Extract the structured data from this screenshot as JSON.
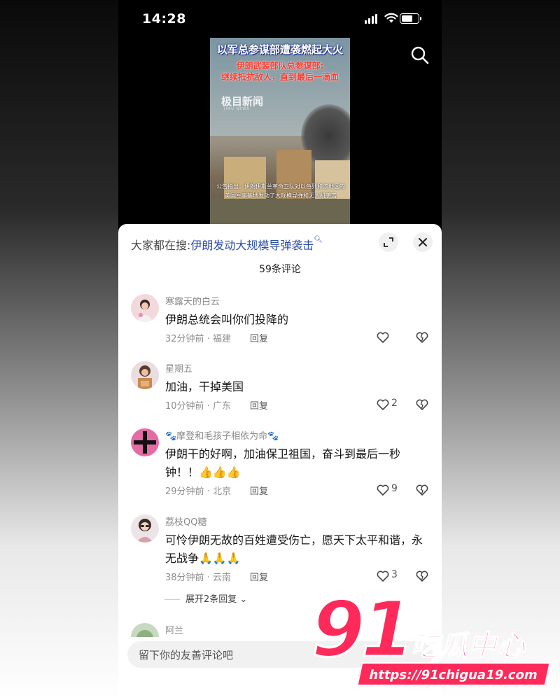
{
  "status_bar": {
    "time": "14:28"
  },
  "video": {
    "headline": "以军总参谋部遭袭燃起大火",
    "subtitle_line1": "伊朗武装部队总参谋部:",
    "subtitle_line2": "继续抵抗敌人，直到最后一滴血",
    "logo": "极目新闻",
    "logo_sub": "JIMU NEWS",
    "caption": "公告指出，伊朗伊斯兰革命卫队对以色列和该地区的美国军事基地发动了大规模导弹和无人机袭击"
  },
  "sheet": {
    "trend_prefix": "大家都在搜:",
    "trend_link": "伊朗发动大规模导弹袭击",
    "comment_count": "59条评论",
    "reply_label": "回复",
    "expand_replies": "展开2条回复",
    "comments": [
      {
        "name": "寒露天的白云",
        "text": "伊朗总统会叫你们投降的",
        "meta": "32分钟前 · 福建",
        "likes": ""
      },
      {
        "name": "星期五",
        "text": "加油，干掉美国",
        "meta": "10分钟前 · 广东",
        "likes": "2"
      },
      {
        "name": "🐾摩登和毛孩子相依为命🐾",
        "text": "伊朗干的好啊，加油保卫祖国，奋斗到最后一秒钟！！👍👍👍",
        "meta": "29分钟前 · 北京",
        "likes": "9"
      },
      {
        "name": "荔枝QQ糖",
        "text": "可怜伊朗无故的百姓遭受伤亡，愿天下太平和谐，永无战争🙏🙏🙏",
        "meta": "38分钟前 · 云南",
        "likes": "3"
      },
      {
        "name": "阿兰",
        "text": "",
        "meta": "",
        "likes": ""
      }
    ],
    "input_placeholder": "留下你的友善评论吧"
  },
  "watermark": {
    "number": "91",
    "title": "吃瓜中心",
    "url": "https://91chigua19.com"
  }
}
